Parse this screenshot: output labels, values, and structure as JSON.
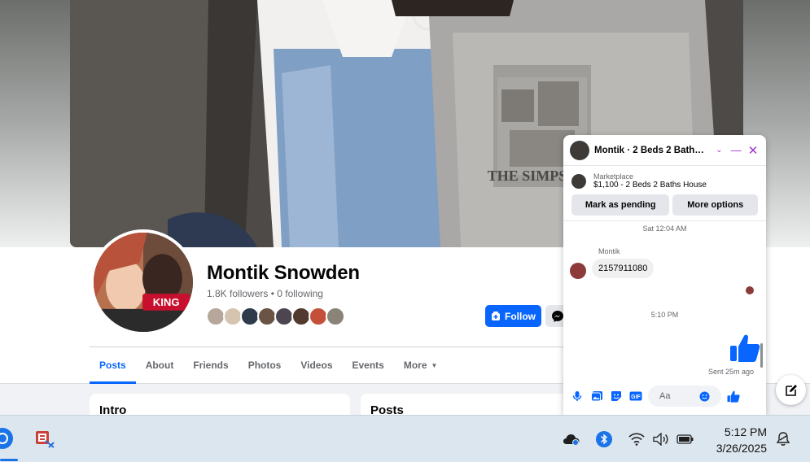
{
  "profile": {
    "name": "Montik Snowden",
    "followers": "1.8K followers",
    "separator": "•",
    "following": "0 following",
    "follow_label": "Follow",
    "avatar_badge": "KING",
    "cover_shirt_text": "THE SIMPSONS"
  },
  "tabs": [
    {
      "label": "Posts"
    },
    {
      "label": "About"
    },
    {
      "label": "Friends"
    },
    {
      "label": "Photos"
    },
    {
      "label": "Videos"
    },
    {
      "label": "Events"
    },
    {
      "label": "More"
    }
  ],
  "cards": {
    "intro_title": "Intro",
    "posts_title": "Posts"
  },
  "chat": {
    "title": "Montik · 2 Beds 2 Baths H...",
    "marketplace_label": "Marketplace",
    "listing": "$1,100 - 2 Beds 2 Baths House",
    "mark_pending": "Mark as pending",
    "more_options": "More options",
    "timestamp1": "Sat 12:04 AM",
    "sender": "Montik",
    "message": "2157911080",
    "timestamp2": "5:10 PM",
    "sent_status": "Sent 25m ago",
    "composer_placeholder": "Aa"
  },
  "taskbar": {
    "time": "5:12 PM",
    "date": "3/26/2025"
  },
  "colors": {
    "accent": "#0866ff",
    "messenger": "#a033d4",
    "like": "#0866ff"
  }
}
